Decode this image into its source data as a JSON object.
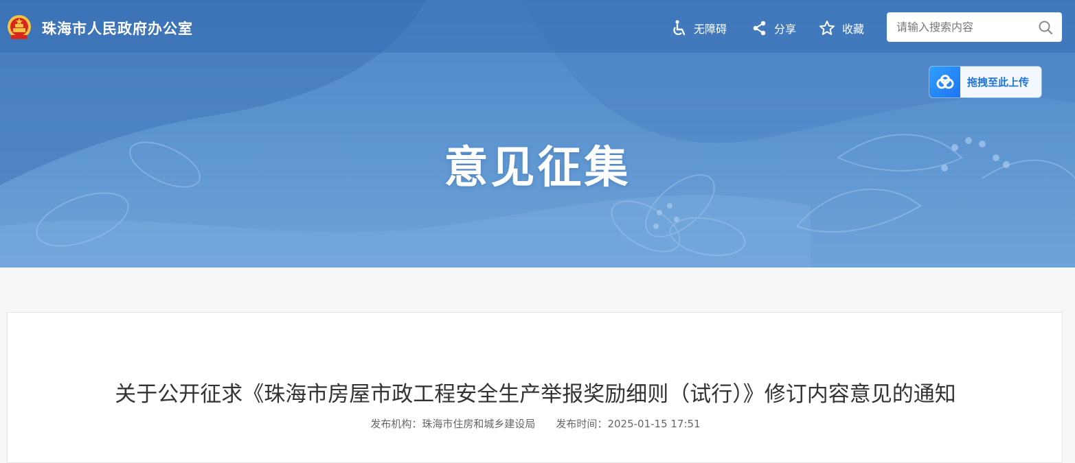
{
  "header": {
    "site_name": "珠海市人民政府办公室",
    "tools": {
      "accessibility": "无障碍",
      "share": "分享",
      "favorite": "收藏"
    },
    "search": {
      "placeholder": "请输入搜索内容"
    }
  },
  "upload_widget": {
    "label": "拖拽至此上传"
  },
  "banner": {
    "title": "意见征集"
  },
  "article": {
    "title": "关于公开征求《珠海市房屋市政工程安全生产举报奖励细则（试行）》修订内容意见的通知",
    "publisher_label": "发布机构：",
    "publisher": "珠海市住房和城乡建设局",
    "publish_time_label": "发布时间：",
    "publish_time": "2025-01-15 17:51"
  },
  "colors": {
    "banner_top": "#4f86c6",
    "banner_bottom": "#6ea3d9",
    "upload_accent": "#1f73e0"
  },
  "icons": {
    "emblem": "national-emblem-icon",
    "accessibility": "wheelchair-icon",
    "share": "share-icon",
    "favorite": "star-icon",
    "search": "search-icon",
    "upload": "cloud-upload-icon"
  }
}
